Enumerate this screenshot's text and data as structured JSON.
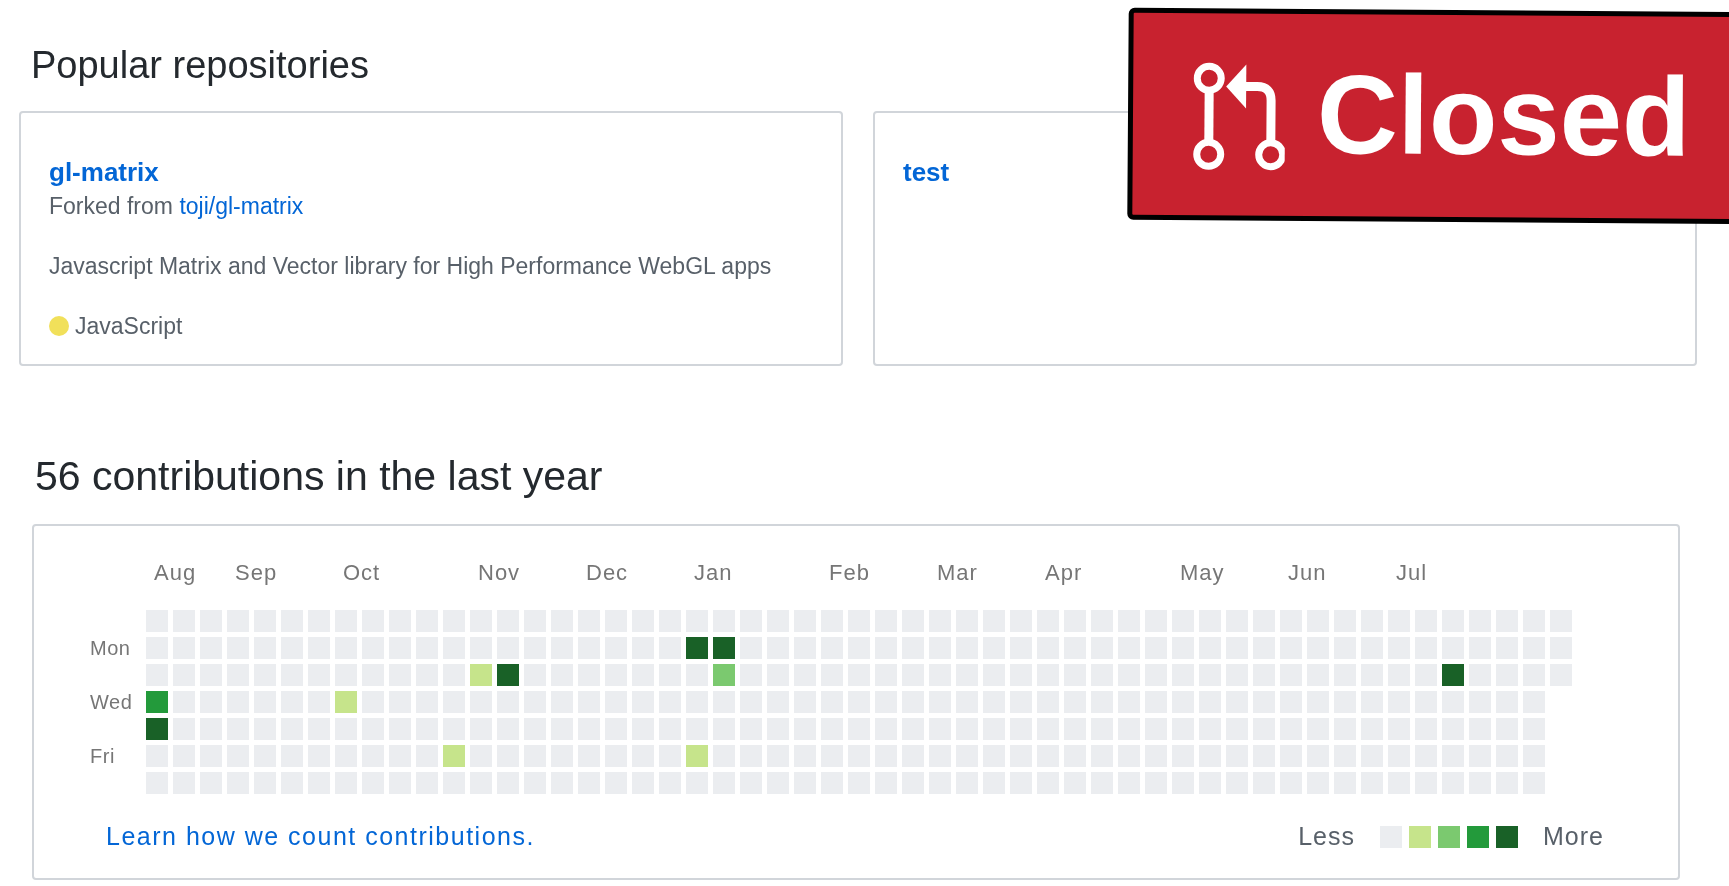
{
  "popular_repositories": {
    "title": "Popular repositories",
    "repos": [
      {
        "name": "gl-matrix",
        "fork_prefix": "Forked from",
        "fork_source": "toji/gl-matrix",
        "description": "Javascript Matrix and Vector library for High Performance WebGL apps",
        "language": {
          "name": "JavaScript",
          "color": "#f1e05a"
        }
      },
      {
        "name": "test"
      }
    ]
  },
  "contributions": {
    "title": "56 contributions in the last year",
    "day_labels": [
      "Mon",
      "Wed",
      "Fri"
    ],
    "weeks": [
      {
        "month": "Aug",
        "days": [
          {
            "color": "#ebedf0"
          },
          {
            "color": "#ebedf0"
          },
          {
            "color": "#ebedf0"
          },
          {
            "color": "#239a3b"
          },
          {
            "color": "#196127"
          },
          {
            "color": "#ebedf0"
          },
          {
            "color": "#ebedf0"
          }
        ]
      },
      {
        "days": [
          {
            "color": "#ebedf0"
          },
          {
            "color": "#ebedf0"
          },
          {
            "color": "#ebedf0"
          },
          {
            "color": "#ebedf0"
          },
          {
            "color": "#ebedf0"
          },
          {
            "color": "#ebedf0"
          },
          {
            "color": "#ebedf0"
          }
        ]
      },
      {
        "days": [
          {
            "color": "#ebedf0"
          },
          {
            "color": "#ebedf0"
          },
          {
            "color": "#ebedf0"
          },
          {
            "color": "#ebedf0"
          },
          {
            "color": "#ebedf0"
          },
          {
            "color": "#ebedf0"
          },
          {
            "color": "#ebedf0"
          }
        ]
      },
      {
        "month": "Sep",
        "days": [
          {
            "color": "#ebedf0"
          },
          {
            "color": "#ebedf0"
          },
          {
            "color": "#ebedf0"
          },
          {
            "color": "#ebedf0"
          },
          {
            "color": "#ebedf0"
          },
          {
            "color": "#ebedf0"
          },
          {
            "color": "#ebedf0"
          }
        ]
      },
      {
        "days": [
          {
            "color": "#ebedf0"
          },
          {
            "color": "#ebedf0"
          },
          {
            "color": "#ebedf0"
          },
          {
            "color": "#ebedf0"
          },
          {
            "color": "#ebedf0"
          },
          {
            "color": "#ebedf0"
          },
          {
            "color": "#ebedf0"
          }
        ]
      },
      {
        "days": [
          {
            "color": "#ebedf0"
          },
          {
            "color": "#ebedf0"
          },
          {
            "color": "#ebedf0"
          },
          {
            "color": "#ebedf0"
          },
          {
            "color": "#ebedf0"
          },
          {
            "color": "#ebedf0"
          },
          {
            "color": "#ebedf0"
          }
        ]
      },
      {
        "days": [
          {
            "color": "#ebedf0"
          },
          {
            "color": "#ebedf0"
          },
          {
            "color": "#ebedf0"
          },
          {
            "color": "#ebedf0"
          },
          {
            "color": "#ebedf0"
          },
          {
            "color": "#ebedf0"
          },
          {
            "color": "#ebedf0"
          }
        ]
      },
      {
        "month": "Oct",
        "days": [
          {
            "color": "#ebedf0"
          },
          {
            "color": "#ebedf0"
          },
          {
            "color": "#ebedf0"
          },
          {
            "color": "#c6e48b"
          },
          {
            "color": "#ebedf0"
          },
          {
            "color": "#ebedf0"
          },
          {
            "color": "#ebedf0"
          }
        ]
      },
      {
        "days": [
          {
            "color": "#ebedf0"
          },
          {
            "color": "#ebedf0"
          },
          {
            "color": "#ebedf0"
          },
          {
            "color": "#ebedf0"
          },
          {
            "color": "#ebedf0"
          },
          {
            "color": "#ebedf0"
          },
          {
            "color": "#ebedf0"
          }
        ]
      },
      {
        "days": [
          {
            "color": "#ebedf0"
          },
          {
            "color": "#ebedf0"
          },
          {
            "color": "#ebedf0"
          },
          {
            "color": "#ebedf0"
          },
          {
            "color": "#ebedf0"
          },
          {
            "color": "#ebedf0"
          },
          {
            "color": "#ebedf0"
          }
        ]
      },
      {
        "days": [
          {
            "color": "#ebedf0"
          },
          {
            "color": "#ebedf0"
          },
          {
            "color": "#ebedf0"
          },
          {
            "color": "#ebedf0"
          },
          {
            "color": "#ebedf0"
          },
          {
            "color": "#ebedf0"
          },
          {
            "color": "#ebedf0"
          }
        ]
      },
      {
        "days": [
          {
            "color": "#ebedf0"
          },
          {
            "color": "#ebedf0"
          },
          {
            "color": "#ebedf0"
          },
          {
            "color": "#ebedf0"
          },
          {
            "color": "#ebedf0"
          },
          {
            "color": "#c6e48b"
          },
          {
            "color": "#ebedf0"
          }
        ]
      },
      {
        "month": "Nov",
        "days": [
          {
            "color": "#ebedf0"
          },
          {
            "color": "#ebedf0"
          },
          {
            "color": "#c6e48b"
          },
          {
            "color": "#ebedf0"
          },
          {
            "color": "#ebedf0"
          },
          {
            "color": "#ebedf0"
          },
          {
            "color": "#ebedf0"
          }
        ]
      },
      {
        "days": [
          {
            "color": "#ebedf0"
          },
          {
            "color": "#ebedf0"
          },
          {
            "color": "#196127"
          },
          {
            "color": "#ebedf0"
          },
          {
            "color": "#ebedf0"
          },
          {
            "color": "#ebedf0"
          },
          {
            "color": "#ebedf0"
          }
        ]
      },
      {
        "days": [
          {
            "color": "#ebedf0"
          },
          {
            "color": "#ebedf0"
          },
          {
            "color": "#ebedf0"
          },
          {
            "color": "#ebedf0"
          },
          {
            "color": "#ebedf0"
          },
          {
            "color": "#ebedf0"
          },
          {
            "color": "#ebedf0"
          }
        ]
      },
      {
        "days": [
          {
            "color": "#ebedf0"
          },
          {
            "color": "#ebedf0"
          },
          {
            "color": "#ebedf0"
          },
          {
            "color": "#ebedf0"
          },
          {
            "color": "#ebedf0"
          },
          {
            "color": "#ebedf0"
          },
          {
            "color": "#ebedf0"
          }
        ]
      },
      {
        "month": "Dec",
        "days": [
          {
            "color": "#ebedf0"
          },
          {
            "color": "#ebedf0"
          },
          {
            "color": "#ebedf0"
          },
          {
            "color": "#ebedf0"
          },
          {
            "color": "#ebedf0"
          },
          {
            "color": "#ebedf0"
          },
          {
            "color": "#ebedf0"
          }
        ]
      },
      {
        "days": [
          {
            "color": "#ebedf0"
          },
          {
            "color": "#ebedf0"
          },
          {
            "color": "#ebedf0"
          },
          {
            "color": "#ebedf0"
          },
          {
            "color": "#ebedf0"
          },
          {
            "color": "#ebedf0"
          },
          {
            "color": "#ebedf0"
          }
        ]
      },
      {
        "days": [
          {
            "color": "#ebedf0"
          },
          {
            "color": "#ebedf0"
          },
          {
            "color": "#ebedf0"
          },
          {
            "color": "#ebedf0"
          },
          {
            "color": "#ebedf0"
          },
          {
            "color": "#ebedf0"
          },
          {
            "color": "#ebedf0"
          }
        ]
      },
      {
        "days": [
          {
            "color": "#ebedf0"
          },
          {
            "color": "#ebedf0"
          },
          {
            "color": "#ebedf0"
          },
          {
            "color": "#ebedf0"
          },
          {
            "color": "#ebedf0"
          },
          {
            "color": "#ebedf0"
          },
          {
            "color": "#ebedf0"
          }
        ]
      },
      {
        "month": "Jan",
        "days": [
          {
            "color": "#ebedf0"
          },
          {
            "color": "#196127"
          },
          {
            "color": "#ebedf0"
          },
          {
            "color": "#ebedf0"
          },
          {
            "color": "#ebedf0"
          },
          {
            "color": "#c6e48b"
          },
          {
            "color": "#ebedf0"
          }
        ]
      },
      {
        "days": [
          {
            "color": "#ebedf0"
          },
          {
            "color": "#196127"
          },
          {
            "color": "#7bc96f"
          },
          {
            "color": "#ebedf0"
          },
          {
            "color": "#ebedf0"
          },
          {
            "color": "#ebedf0"
          },
          {
            "color": "#ebedf0"
          }
        ]
      },
      {
        "days": [
          {
            "color": "#ebedf0"
          },
          {
            "color": "#ebedf0"
          },
          {
            "color": "#ebedf0"
          },
          {
            "color": "#ebedf0"
          },
          {
            "color": "#ebedf0"
          },
          {
            "color": "#ebedf0"
          },
          {
            "color": "#ebedf0"
          }
        ]
      },
      {
        "days": [
          {
            "color": "#ebedf0"
          },
          {
            "color": "#ebedf0"
          },
          {
            "color": "#ebedf0"
          },
          {
            "color": "#ebedf0"
          },
          {
            "color": "#ebedf0"
          },
          {
            "color": "#ebedf0"
          },
          {
            "color": "#ebedf0"
          }
        ]
      },
      {
        "days": [
          {
            "color": "#ebedf0"
          },
          {
            "color": "#ebedf0"
          },
          {
            "color": "#ebedf0"
          },
          {
            "color": "#ebedf0"
          },
          {
            "color": "#ebedf0"
          },
          {
            "color": "#ebedf0"
          },
          {
            "color": "#ebedf0"
          }
        ]
      },
      {
        "month": "Feb",
        "days": [
          {
            "color": "#ebedf0"
          },
          {
            "color": "#ebedf0"
          },
          {
            "color": "#ebedf0"
          },
          {
            "color": "#ebedf0"
          },
          {
            "color": "#ebedf0"
          },
          {
            "color": "#ebedf0"
          },
          {
            "color": "#ebedf0"
          }
        ]
      },
      {
        "days": [
          {
            "color": "#ebedf0"
          },
          {
            "color": "#ebedf0"
          },
          {
            "color": "#ebedf0"
          },
          {
            "color": "#ebedf0"
          },
          {
            "color": "#ebedf0"
          },
          {
            "color": "#ebedf0"
          },
          {
            "color": "#ebedf0"
          }
        ]
      },
      {
        "days": [
          {
            "color": "#ebedf0"
          },
          {
            "color": "#ebedf0"
          },
          {
            "color": "#ebedf0"
          },
          {
            "color": "#ebedf0"
          },
          {
            "color": "#ebedf0"
          },
          {
            "color": "#ebedf0"
          },
          {
            "color": "#ebedf0"
          }
        ]
      },
      {
        "days": [
          {
            "color": "#ebedf0"
          },
          {
            "color": "#ebedf0"
          },
          {
            "color": "#ebedf0"
          },
          {
            "color": "#ebedf0"
          },
          {
            "color": "#ebedf0"
          },
          {
            "color": "#ebedf0"
          },
          {
            "color": "#ebedf0"
          }
        ]
      },
      {
        "month": "Mar",
        "days": [
          {
            "color": "#ebedf0"
          },
          {
            "color": "#ebedf0"
          },
          {
            "color": "#ebedf0"
          },
          {
            "color": "#ebedf0"
          },
          {
            "color": "#ebedf0"
          },
          {
            "color": "#ebedf0"
          },
          {
            "color": "#ebedf0"
          }
        ]
      },
      {
        "days": [
          {
            "color": "#ebedf0"
          },
          {
            "color": "#ebedf0"
          },
          {
            "color": "#ebedf0"
          },
          {
            "color": "#ebedf0"
          },
          {
            "color": "#ebedf0"
          },
          {
            "color": "#ebedf0"
          },
          {
            "color": "#ebedf0"
          }
        ]
      },
      {
        "days": [
          {
            "color": "#ebedf0"
          },
          {
            "color": "#ebedf0"
          },
          {
            "color": "#ebedf0"
          },
          {
            "color": "#ebedf0"
          },
          {
            "color": "#ebedf0"
          },
          {
            "color": "#ebedf0"
          },
          {
            "color": "#ebedf0"
          }
        ]
      },
      {
        "days": [
          {
            "color": "#ebedf0"
          },
          {
            "color": "#ebedf0"
          },
          {
            "color": "#ebedf0"
          },
          {
            "color": "#ebedf0"
          },
          {
            "color": "#ebedf0"
          },
          {
            "color": "#ebedf0"
          },
          {
            "color": "#ebedf0"
          }
        ]
      },
      {
        "month": "Apr",
        "days": [
          {
            "color": "#ebedf0"
          },
          {
            "color": "#ebedf0"
          },
          {
            "color": "#ebedf0"
          },
          {
            "color": "#ebedf0"
          },
          {
            "color": "#ebedf0"
          },
          {
            "color": "#ebedf0"
          },
          {
            "color": "#ebedf0"
          }
        ]
      },
      {
        "days": [
          {
            "color": "#ebedf0"
          },
          {
            "color": "#ebedf0"
          },
          {
            "color": "#ebedf0"
          },
          {
            "color": "#ebedf0"
          },
          {
            "color": "#ebedf0"
          },
          {
            "color": "#ebedf0"
          },
          {
            "color": "#ebedf0"
          }
        ]
      },
      {
        "days": [
          {
            "color": "#ebedf0"
          },
          {
            "color": "#ebedf0"
          },
          {
            "color": "#ebedf0"
          },
          {
            "color": "#ebedf0"
          },
          {
            "color": "#ebedf0"
          },
          {
            "color": "#ebedf0"
          },
          {
            "color": "#ebedf0"
          }
        ]
      },
      {
        "days": [
          {
            "color": "#ebedf0"
          },
          {
            "color": "#ebedf0"
          },
          {
            "color": "#ebedf0"
          },
          {
            "color": "#ebedf0"
          },
          {
            "color": "#ebedf0"
          },
          {
            "color": "#ebedf0"
          },
          {
            "color": "#ebedf0"
          }
        ]
      },
      {
        "days": [
          {
            "color": "#ebedf0"
          },
          {
            "color": "#ebedf0"
          },
          {
            "color": "#ebedf0"
          },
          {
            "color": "#ebedf0"
          },
          {
            "color": "#ebedf0"
          },
          {
            "color": "#ebedf0"
          },
          {
            "color": "#ebedf0"
          }
        ]
      },
      {
        "month": "May",
        "days": [
          {
            "color": "#ebedf0"
          },
          {
            "color": "#ebedf0"
          },
          {
            "color": "#ebedf0"
          },
          {
            "color": "#ebedf0"
          },
          {
            "color": "#ebedf0"
          },
          {
            "color": "#ebedf0"
          },
          {
            "color": "#ebedf0"
          }
        ]
      },
      {
        "days": [
          {
            "color": "#ebedf0"
          },
          {
            "color": "#ebedf0"
          },
          {
            "color": "#ebedf0"
          },
          {
            "color": "#ebedf0"
          },
          {
            "color": "#ebedf0"
          },
          {
            "color": "#ebedf0"
          },
          {
            "color": "#ebedf0"
          }
        ]
      },
      {
        "days": [
          {
            "color": "#ebedf0"
          },
          {
            "color": "#ebedf0"
          },
          {
            "color": "#ebedf0"
          },
          {
            "color": "#ebedf0"
          },
          {
            "color": "#ebedf0"
          },
          {
            "color": "#ebedf0"
          },
          {
            "color": "#ebedf0"
          }
        ]
      },
      {
        "days": [
          {
            "color": "#ebedf0"
          },
          {
            "color": "#ebedf0"
          },
          {
            "color": "#ebedf0"
          },
          {
            "color": "#ebedf0"
          },
          {
            "color": "#ebedf0"
          },
          {
            "color": "#ebedf0"
          },
          {
            "color": "#ebedf0"
          }
        ]
      },
      {
        "month": "Jun",
        "days": [
          {
            "color": "#ebedf0"
          },
          {
            "color": "#ebedf0"
          },
          {
            "color": "#ebedf0"
          },
          {
            "color": "#ebedf0"
          },
          {
            "color": "#ebedf0"
          },
          {
            "color": "#ebedf0"
          },
          {
            "color": "#ebedf0"
          }
        ]
      },
      {
        "days": [
          {
            "color": "#ebedf0"
          },
          {
            "color": "#ebedf0"
          },
          {
            "color": "#ebedf0"
          },
          {
            "color": "#ebedf0"
          },
          {
            "color": "#ebedf0"
          },
          {
            "color": "#ebedf0"
          },
          {
            "color": "#ebedf0"
          }
        ]
      },
      {
        "days": [
          {
            "color": "#ebedf0"
          },
          {
            "color": "#ebedf0"
          },
          {
            "color": "#ebedf0"
          },
          {
            "color": "#ebedf0"
          },
          {
            "color": "#ebedf0"
          },
          {
            "color": "#ebedf0"
          },
          {
            "color": "#ebedf0"
          }
        ]
      },
      {
        "days": [
          {
            "color": "#ebedf0"
          },
          {
            "color": "#ebedf0"
          },
          {
            "color": "#ebedf0"
          },
          {
            "color": "#ebedf0"
          },
          {
            "color": "#ebedf0"
          },
          {
            "color": "#ebedf0"
          },
          {
            "color": "#ebedf0"
          }
        ]
      },
      {
        "month": "Jul",
        "days": [
          {
            "color": "#ebedf0"
          },
          {
            "color": "#ebedf0"
          },
          {
            "color": "#ebedf0"
          },
          {
            "color": "#ebedf0"
          },
          {
            "color": "#ebedf0"
          },
          {
            "color": "#ebedf0"
          },
          {
            "color": "#ebedf0"
          }
        ]
      },
      {
        "days": [
          {
            "color": "#ebedf0"
          },
          {
            "color": "#ebedf0"
          },
          {
            "color": "#ebedf0"
          },
          {
            "color": "#ebedf0"
          },
          {
            "color": "#ebedf0"
          },
          {
            "color": "#ebedf0"
          },
          {
            "color": "#ebedf0"
          }
        ]
      },
      {
        "days": [
          {
            "color": "#ebedf0"
          },
          {
            "color": "#ebedf0"
          },
          {
            "color": "#196127"
          },
          {
            "color": "#ebedf0"
          },
          {
            "color": "#ebedf0"
          },
          {
            "color": "#ebedf0"
          },
          {
            "color": "#ebedf0"
          }
        ]
      },
      {
        "days": [
          {
            "color": "#ebedf0"
          },
          {
            "color": "#ebedf0"
          },
          {
            "color": "#ebedf0"
          },
          {
            "color": "#ebedf0"
          },
          {
            "color": "#ebedf0"
          },
          {
            "color": "#ebedf0"
          },
          {
            "color": "#ebedf0"
          }
        ]
      },
      {
        "days": [
          {
            "color": "#ebedf0"
          },
          {
            "color": "#ebedf0"
          },
          {
            "color": "#ebedf0"
          },
          {
            "color": "#ebedf0"
          },
          {
            "color": "#ebedf0"
          },
          {
            "color": "#ebedf0"
          },
          {
            "color": "#ebedf0"
          }
        ]
      },
      {
        "days": [
          {
            "color": "#ebedf0"
          },
          {
            "color": "#ebedf0"
          },
          {
            "color": "#ebedf0"
          },
          {
            "color": "#ebedf0"
          },
          {
            "color": "#ebedf0"
          },
          {
            "color": "#ebedf0"
          },
          {
            "color": "#ebedf0"
          }
        ]
      },
      {
        "days": [
          {
            "color": "#ebedf0"
          },
          {
            "color": "#ebedf0"
          },
          {
            "color": "#ebedf0"
          }
        ]
      }
    ],
    "learn_link": "Learn how we count contributions.",
    "legend": {
      "less": "Less",
      "swatches": [
        {
          "color": "#ebedf0"
        },
        {
          "color": "#c6e48b"
        },
        {
          "color": "#7bc96f"
        },
        {
          "color": "#239a3b"
        },
        {
          "color": "#196127"
        }
      ],
      "more": "More"
    }
  },
  "badge": {
    "label": "Closed"
  }
}
